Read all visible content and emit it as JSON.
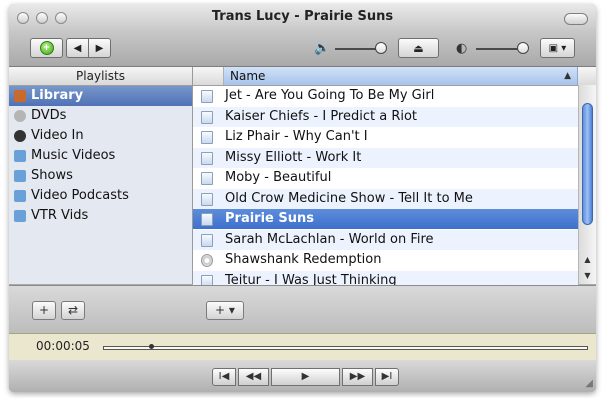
{
  "window": {
    "title": "Trans Lucy - Prairie Suns",
    "traffic_lights": [
      "close",
      "minimize",
      "zoom"
    ]
  },
  "toolbar": {
    "icons": [
      "add-green-icon",
      "previous-icon",
      "next-icon",
      "volume-icon",
      "eject-icon",
      "contrast-icon",
      "display-menu-icon"
    ]
  },
  "sidebar": {
    "header": "Playlists",
    "items": [
      {
        "label": "Library",
        "icon": "library-icon",
        "selected": true,
        "color": "#c76a2a"
      },
      {
        "label": "DVDs",
        "icon": "dvd-icon",
        "selected": false,
        "color": "#b5b5b5"
      },
      {
        "label": "Video In",
        "icon": "video-in-icon",
        "selected": false,
        "color": "#333333"
      },
      {
        "label": "Music Videos",
        "icon": "playlist-icon",
        "selected": false,
        "color": "#6aa0d8"
      },
      {
        "label": "Shows",
        "icon": "playlist-icon",
        "selected": false,
        "color": "#6aa0d8"
      },
      {
        "label": "Video Podcasts",
        "icon": "playlist-icon",
        "selected": false,
        "color": "#6aa0d8"
      },
      {
        "label": "VTR Vids",
        "icon": "playlist-icon",
        "selected": false,
        "color": "#6aa0d8"
      }
    ]
  },
  "list": {
    "column_header": "Name",
    "rows": [
      {
        "name": "Jet - Are You Going To Be My Girl",
        "icon": "movie-file-icon",
        "selected": false
      },
      {
        "name": "Kaiser Chiefs - I Predict a Riot",
        "icon": "movie-file-icon",
        "selected": false
      },
      {
        "name": "Liz Phair - Why Can't I",
        "icon": "movie-file-icon",
        "selected": false
      },
      {
        "name": "Missy Elliott - Work It",
        "icon": "movie-file-icon",
        "selected": false
      },
      {
        "name": "Moby - Beautiful",
        "icon": "movie-file-icon",
        "selected": false
      },
      {
        "name": "Old Crow Medicine Show - Tell It to Me",
        "icon": "movie-file-icon",
        "selected": false
      },
      {
        "name": "Prairie Suns",
        "icon": "movie-file-icon",
        "selected": true
      },
      {
        "name": "Sarah McLachlan - World on Fire",
        "icon": "movie-file-icon",
        "selected": false
      },
      {
        "name": "Shawshank Redemption",
        "icon": "dvd-icon",
        "selected": false
      },
      {
        "name": "Teitur - I Was Just Thinking",
        "icon": "movie-file-icon",
        "selected": false
      }
    ]
  },
  "bottom": {
    "add_label": "+",
    "sync_label": "⇄",
    "add_menu_label": "+ ▾"
  },
  "playback": {
    "time": "00:00:05",
    "progress_fraction": 0.01
  },
  "transport": {
    "labels": [
      "I◀",
      "◀◀",
      "▶",
      "▶▶",
      "▶I"
    ]
  }
}
